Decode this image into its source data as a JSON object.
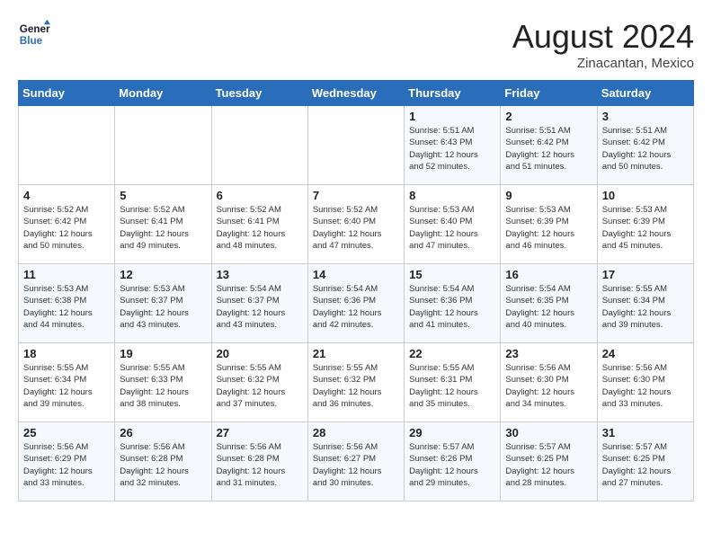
{
  "logo": {
    "line1": "General",
    "line2": "Blue"
  },
  "title": "August 2024",
  "location": "Zinacantan, Mexico",
  "days_of_week": [
    "Sunday",
    "Monday",
    "Tuesday",
    "Wednesday",
    "Thursday",
    "Friday",
    "Saturday"
  ],
  "weeks": [
    [
      {
        "day": "",
        "info": ""
      },
      {
        "day": "",
        "info": ""
      },
      {
        "day": "",
        "info": ""
      },
      {
        "day": "",
        "info": ""
      },
      {
        "day": "1",
        "info": "Sunrise: 5:51 AM\nSunset: 6:43 PM\nDaylight: 12 hours\nand 52 minutes."
      },
      {
        "day": "2",
        "info": "Sunrise: 5:51 AM\nSunset: 6:42 PM\nDaylight: 12 hours\nand 51 minutes."
      },
      {
        "day": "3",
        "info": "Sunrise: 5:51 AM\nSunset: 6:42 PM\nDaylight: 12 hours\nand 50 minutes."
      }
    ],
    [
      {
        "day": "4",
        "info": "Sunrise: 5:52 AM\nSunset: 6:42 PM\nDaylight: 12 hours\nand 50 minutes."
      },
      {
        "day": "5",
        "info": "Sunrise: 5:52 AM\nSunset: 6:41 PM\nDaylight: 12 hours\nand 49 minutes."
      },
      {
        "day": "6",
        "info": "Sunrise: 5:52 AM\nSunset: 6:41 PM\nDaylight: 12 hours\nand 48 minutes."
      },
      {
        "day": "7",
        "info": "Sunrise: 5:52 AM\nSunset: 6:40 PM\nDaylight: 12 hours\nand 47 minutes."
      },
      {
        "day": "8",
        "info": "Sunrise: 5:53 AM\nSunset: 6:40 PM\nDaylight: 12 hours\nand 47 minutes."
      },
      {
        "day": "9",
        "info": "Sunrise: 5:53 AM\nSunset: 6:39 PM\nDaylight: 12 hours\nand 46 minutes."
      },
      {
        "day": "10",
        "info": "Sunrise: 5:53 AM\nSunset: 6:39 PM\nDaylight: 12 hours\nand 45 minutes."
      }
    ],
    [
      {
        "day": "11",
        "info": "Sunrise: 5:53 AM\nSunset: 6:38 PM\nDaylight: 12 hours\nand 44 minutes."
      },
      {
        "day": "12",
        "info": "Sunrise: 5:53 AM\nSunset: 6:37 PM\nDaylight: 12 hours\nand 43 minutes."
      },
      {
        "day": "13",
        "info": "Sunrise: 5:54 AM\nSunset: 6:37 PM\nDaylight: 12 hours\nand 43 minutes."
      },
      {
        "day": "14",
        "info": "Sunrise: 5:54 AM\nSunset: 6:36 PM\nDaylight: 12 hours\nand 42 minutes."
      },
      {
        "day": "15",
        "info": "Sunrise: 5:54 AM\nSunset: 6:36 PM\nDaylight: 12 hours\nand 41 minutes."
      },
      {
        "day": "16",
        "info": "Sunrise: 5:54 AM\nSunset: 6:35 PM\nDaylight: 12 hours\nand 40 minutes."
      },
      {
        "day": "17",
        "info": "Sunrise: 5:55 AM\nSunset: 6:34 PM\nDaylight: 12 hours\nand 39 minutes."
      }
    ],
    [
      {
        "day": "18",
        "info": "Sunrise: 5:55 AM\nSunset: 6:34 PM\nDaylight: 12 hours\nand 39 minutes."
      },
      {
        "day": "19",
        "info": "Sunrise: 5:55 AM\nSunset: 6:33 PM\nDaylight: 12 hours\nand 38 minutes."
      },
      {
        "day": "20",
        "info": "Sunrise: 5:55 AM\nSunset: 6:32 PM\nDaylight: 12 hours\nand 37 minutes."
      },
      {
        "day": "21",
        "info": "Sunrise: 5:55 AM\nSunset: 6:32 PM\nDaylight: 12 hours\nand 36 minutes."
      },
      {
        "day": "22",
        "info": "Sunrise: 5:55 AM\nSunset: 6:31 PM\nDaylight: 12 hours\nand 35 minutes."
      },
      {
        "day": "23",
        "info": "Sunrise: 5:56 AM\nSunset: 6:30 PM\nDaylight: 12 hours\nand 34 minutes."
      },
      {
        "day": "24",
        "info": "Sunrise: 5:56 AM\nSunset: 6:30 PM\nDaylight: 12 hours\nand 33 minutes."
      }
    ],
    [
      {
        "day": "25",
        "info": "Sunrise: 5:56 AM\nSunset: 6:29 PM\nDaylight: 12 hours\nand 33 minutes."
      },
      {
        "day": "26",
        "info": "Sunrise: 5:56 AM\nSunset: 6:28 PM\nDaylight: 12 hours\nand 32 minutes."
      },
      {
        "day": "27",
        "info": "Sunrise: 5:56 AM\nSunset: 6:28 PM\nDaylight: 12 hours\nand 31 minutes."
      },
      {
        "day": "28",
        "info": "Sunrise: 5:56 AM\nSunset: 6:27 PM\nDaylight: 12 hours\nand 30 minutes."
      },
      {
        "day": "29",
        "info": "Sunrise: 5:57 AM\nSunset: 6:26 PM\nDaylight: 12 hours\nand 29 minutes."
      },
      {
        "day": "30",
        "info": "Sunrise: 5:57 AM\nSunset: 6:25 PM\nDaylight: 12 hours\nand 28 minutes."
      },
      {
        "day": "31",
        "info": "Sunrise: 5:57 AM\nSunset: 6:25 PM\nDaylight: 12 hours\nand 27 minutes."
      }
    ]
  ]
}
